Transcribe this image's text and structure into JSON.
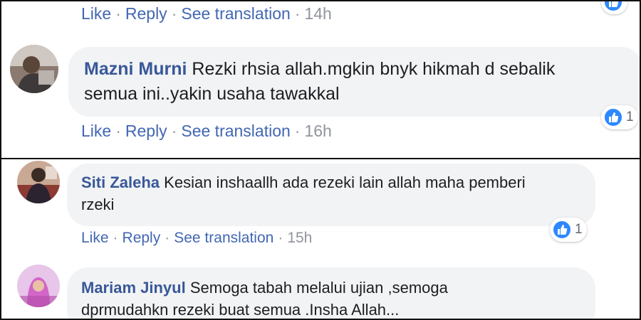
{
  "top_block": {
    "comment0": {
      "actions": {
        "like": "Like",
        "reply": "Reply",
        "translate": "See translation",
        "time": "14h"
      }
    },
    "comment1": {
      "author": "Mazni Murni",
      "text_line1": "Rezki rhsia allah.mgkin bnyk hikmah d sebalik",
      "text_line2": "semua ini..yakin usaha tawakkal",
      "actions": {
        "like": "Like",
        "reply": "Reply",
        "translate": "See translation",
        "time": "16h"
      },
      "reaction_count": "1"
    }
  },
  "bottom_block": {
    "comment1": {
      "author": "Siti Zaleha",
      "text_line1": "Kesian inshaallh ada rezeki lain allah maha pemberi",
      "text_line2": "rzeki",
      "actions": {
        "like": "Like",
        "reply": "Reply",
        "translate": "See translation",
        "time": "15h"
      },
      "reaction_count": "1"
    },
    "comment2": {
      "author": "Mariam Jinyul",
      "text_line1": "Semoga tabah melalui ujian ,semoga",
      "text_line2": "dprmudahkn rezeki buat semua .Insha Allah..."
    }
  },
  "separator": "·",
  "icons": {
    "reaction": "like-thumb-icon",
    "avatar": "user-avatar"
  },
  "colors": {
    "link": "#4267b2",
    "name": "#385898",
    "bubble": "#f2f3f5",
    "like_badge": "#2d88ff",
    "meta": "#90949c"
  }
}
